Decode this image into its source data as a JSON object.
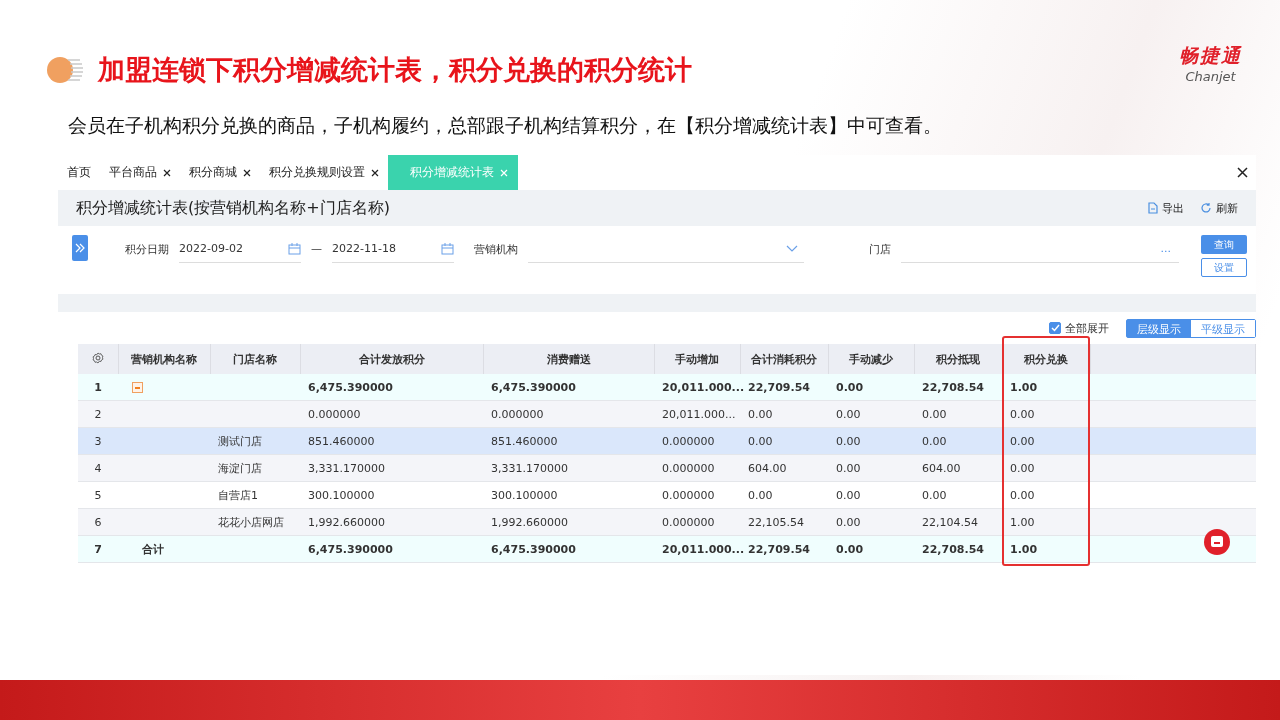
{
  "slide": {
    "title": "加盟连锁下积分增减统计表，积分兑换的积分统计",
    "logo_cn": "畅捷通",
    "logo_en": "Chanjet",
    "subtitle": "会员在子机构积分兑换的商品，子机构履约，总部跟子机构结算积分，在【积分增减统计表】中可查看。"
  },
  "tabs": [
    {
      "label": "首页",
      "closable": false,
      "selected": false
    },
    {
      "label": "平台商品",
      "closable": true,
      "selected": false
    },
    {
      "label": "积分商城",
      "closable": true,
      "selected": false
    },
    {
      "label": "积分兑换规则设置",
      "closable": true,
      "selected": false
    },
    {
      "label": "积分增减统计表",
      "closable": true,
      "selected": true
    }
  ],
  "report": {
    "title": "积分增减统计表(按营销机构名称+门店名称)",
    "actions": [
      "导出",
      "刷新"
    ]
  },
  "filters": {
    "date_label": "积分日期",
    "date_from": "2022-09-02",
    "date_sep": "—",
    "date_to": "2022-11-18",
    "org_label": "营销机构",
    "store_label": "门店",
    "store_more": "...",
    "query_button": "查询",
    "settings_button": "设置"
  },
  "view": {
    "expand_all": {
      "label": "全部展开",
      "checked": true
    },
    "modes": [
      {
        "label": "层级显示",
        "selected": true
      },
      {
        "label": "平级显示",
        "selected": false
      }
    ]
  },
  "table": {
    "columns": [
      {
        "label": "营销机构名称",
        "highlighted": false
      },
      {
        "label": "门店名称",
        "highlighted": false
      },
      {
        "label": "合计发放积分",
        "highlighted": false
      },
      {
        "label": "消费赠送",
        "highlighted": false
      },
      {
        "label": "手动增加",
        "highlighted": false
      },
      {
        "label": "合计消耗积分",
        "highlighted": false
      },
      {
        "label": "手动减少",
        "highlighted": false
      },
      {
        "label": "积分抵现",
        "highlighted": false
      },
      {
        "label": "积分兑换",
        "highlighted": true
      }
    ],
    "rows": [
      {
        "no": "1",
        "kind": "summary",
        "selected": false,
        "expanded": true,
        "org": "",
        "store": "",
        "values": [
          "6,475.390000",
          "6,475.390000",
          "20,011.000...",
          "22,709.54",
          "0.00",
          "22,708.54",
          "1.00"
        ]
      },
      {
        "no": "2",
        "kind": "detail",
        "selected": false,
        "org": "",
        "store": "",
        "values": [
          "0.000000",
          "0.000000",
          "20,011.000...",
          "0.00",
          "0.00",
          "0.00",
          "0.00"
        ]
      },
      {
        "no": "3",
        "kind": "detail",
        "selected": true,
        "org": "",
        "store": "测试门店",
        "values": [
          "851.460000",
          "851.460000",
          "0.000000",
          "0.00",
          "0.00",
          "0.00",
          "0.00"
        ]
      },
      {
        "no": "4",
        "kind": "detail",
        "selected": false,
        "org": "",
        "store": "海淀门店",
        "values": [
          "3,331.170000",
          "3,331.170000",
          "0.000000",
          "604.00",
          "0.00",
          "604.00",
          "0.00"
        ]
      },
      {
        "no": "5",
        "kind": "detail",
        "selected": false,
        "org": "",
        "store": "自营店1",
        "values": [
          "300.100000",
          "300.100000",
          "0.000000",
          "0.00",
          "0.00",
          "0.00",
          "0.00"
        ]
      },
      {
        "no": "6",
        "kind": "detail",
        "selected": false,
        "org": "",
        "store": "花花小店网店",
        "values": [
          "1,992.660000",
          "1,992.660000",
          "0.000000",
          "22,105.54",
          "0.00",
          "22,104.54",
          "1.00"
        ]
      },
      {
        "no": "7",
        "kind": "summary",
        "selected": false,
        "org": "合计",
        "store": "",
        "values": [
          "6,475.390000",
          "6,475.390000",
          "20,011.000...",
          "22,709.54",
          "0.00",
          "22,708.54",
          "1.00"
        ]
      }
    ]
  }
}
